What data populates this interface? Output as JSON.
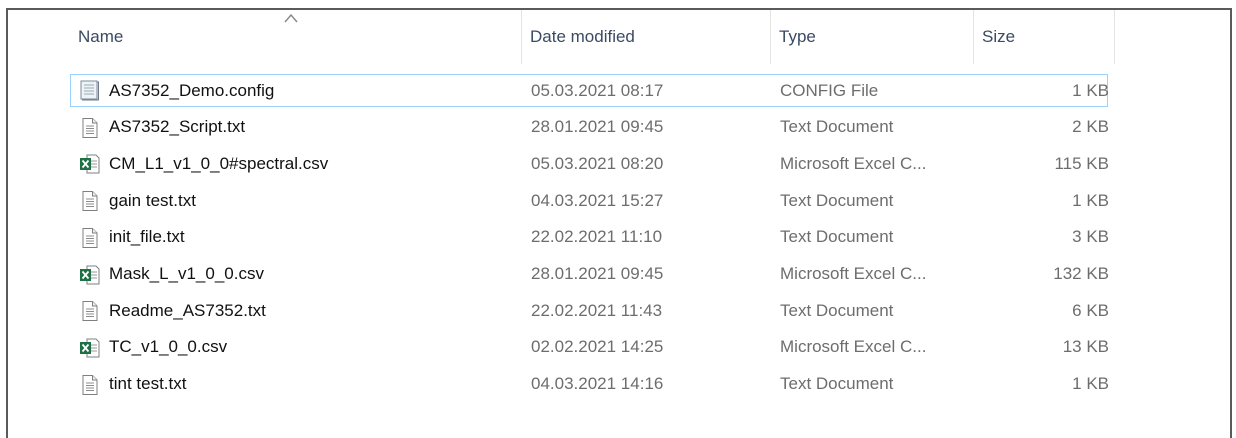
{
  "header": {
    "columns": [
      {
        "key": "name",
        "label": "Name",
        "sorted": true
      },
      {
        "key": "date",
        "label": "Date modified"
      },
      {
        "key": "type",
        "label": "Type"
      },
      {
        "key": "size",
        "label": "Size"
      }
    ]
  },
  "files": [
    {
      "name": "AS7352_Demo.config",
      "date": "05.03.2021 08:17",
      "type": "CONFIG File",
      "size": "1 KB",
      "icon": "config-file-icon",
      "focused": true
    },
    {
      "name": "AS7352_Script.txt",
      "date": "28.01.2021 09:45",
      "type": "Text Document",
      "size": "2 KB",
      "icon": "text-document-icon"
    },
    {
      "name": "CM_L1_v1_0_0#spectral.csv",
      "date": "05.03.2021 08:20",
      "type": "Microsoft Excel C...",
      "size": "115 KB",
      "icon": "excel-csv-icon"
    },
    {
      "name": "gain test.txt",
      "date": "04.03.2021 15:27",
      "type": "Text Document",
      "size": "1 KB",
      "icon": "text-document-icon"
    },
    {
      "name": "init_file.txt",
      "date": "22.02.2021 11:10",
      "type": "Text Document",
      "size": "3 KB",
      "icon": "text-document-icon"
    },
    {
      "name": "Mask_L_v1_0_0.csv",
      "date": "28.01.2021 09:45",
      "type": "Microsoft Excel C...",
      "size": "132 KB",
      "icon": "excel-csv-icon"
    },
    {
      "name": "Readme_AS7352.txt",
      "date": "22.02.2021 11:43",
      "type": "Text Document",
      "size": "6 KB",
      "icon": "text-document-icon"
    },
    {
      "name": "TC_v1_0_0.csv",
      "date": "02.02.2021 14:25",
      "type": "Microsoft Excel C...",
      "size": "13 KB",
      "icon": "excel-csv-icon"
    },
    {
      "name": "tint test.txt",
      "date": "04.03.2021 14:16",
      "type": "Text Document",
      "size": "1 KB",
      "icon": "text-document-icon"
    }
  ],
  "colors": {
    "header_text": "#3a4a63",
    "focus_border": "#99d1ff",
    "excel_green": "#1e7145",
    "meta_text": "#6d6d6d"
  }
}
